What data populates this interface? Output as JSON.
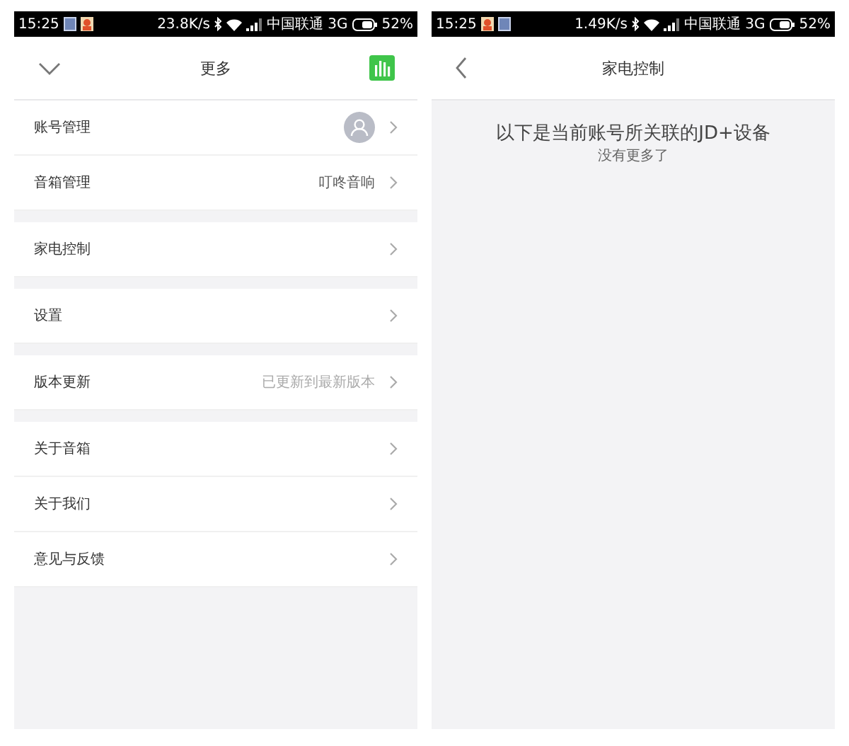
{
  "screens": [
    {
      "status_bar": {
        "time": "15:25",
        "notifications": [
          {
            "kind": "note"
          },
          {
            "kind": "app"
          }
        ],
        "speed": "23.8K/s",
        "carrier": "中国联通 3G",
        "battery": "52%"
      },
      "header": {
        "title": "更多",
        "left_icon": {
          "kind": "collapse"
        },
        "right_icon": {
          "kind": "equalizer"
        }
      },
      "sections": [
        {
          "rows": [
            {
              "label": "账号管理",
              "kind": "avatar"
            },
            {
              "label": "音箱管理",
              "kind": "value",
              "value": "叮咚音响"
            }
          ]
        },
        {
          "rows": [
            {
              "label": "家电控制",
              "kind": "plain"
            }
          ]
        },
        {
          "rows": [
            {
              "label": "设置",
              "kind": "plain"
            }
          ]
        },
        {
          "rows": [
            {
              "label": "版本更新",
              "kind": "hint",
              "value": "已更新到最新版本"
            }
          ]
        },
        {
          "rows": [
            {
              "label": "关于音箱",
              "kind": "plain"
            },
            {
              "label": "关于我们",
              "kind": "plain"
            },
            {
              "label": "意见与反馈",
              "kind": "plain"
            }
          ]
        }
      ]
    },
    {
      "status_bar": {
        "time": "15:25",
        "notifications": [
          {
            "kind": "app"
          },
          {
            "kind": "note"
          }
        ],
        "speed": "1.49K/s",
        "carrier": "中国联通 3G",
        "battery": "52%"
      },
      "header": {
        "title": "家电控制",
        "left_icon": {
          "kind": "back"
        }
      },
      "message": "以下是当前账号所关联的JD+设备",
      "sub_message": "没有更多了"
    }
  ]
}
